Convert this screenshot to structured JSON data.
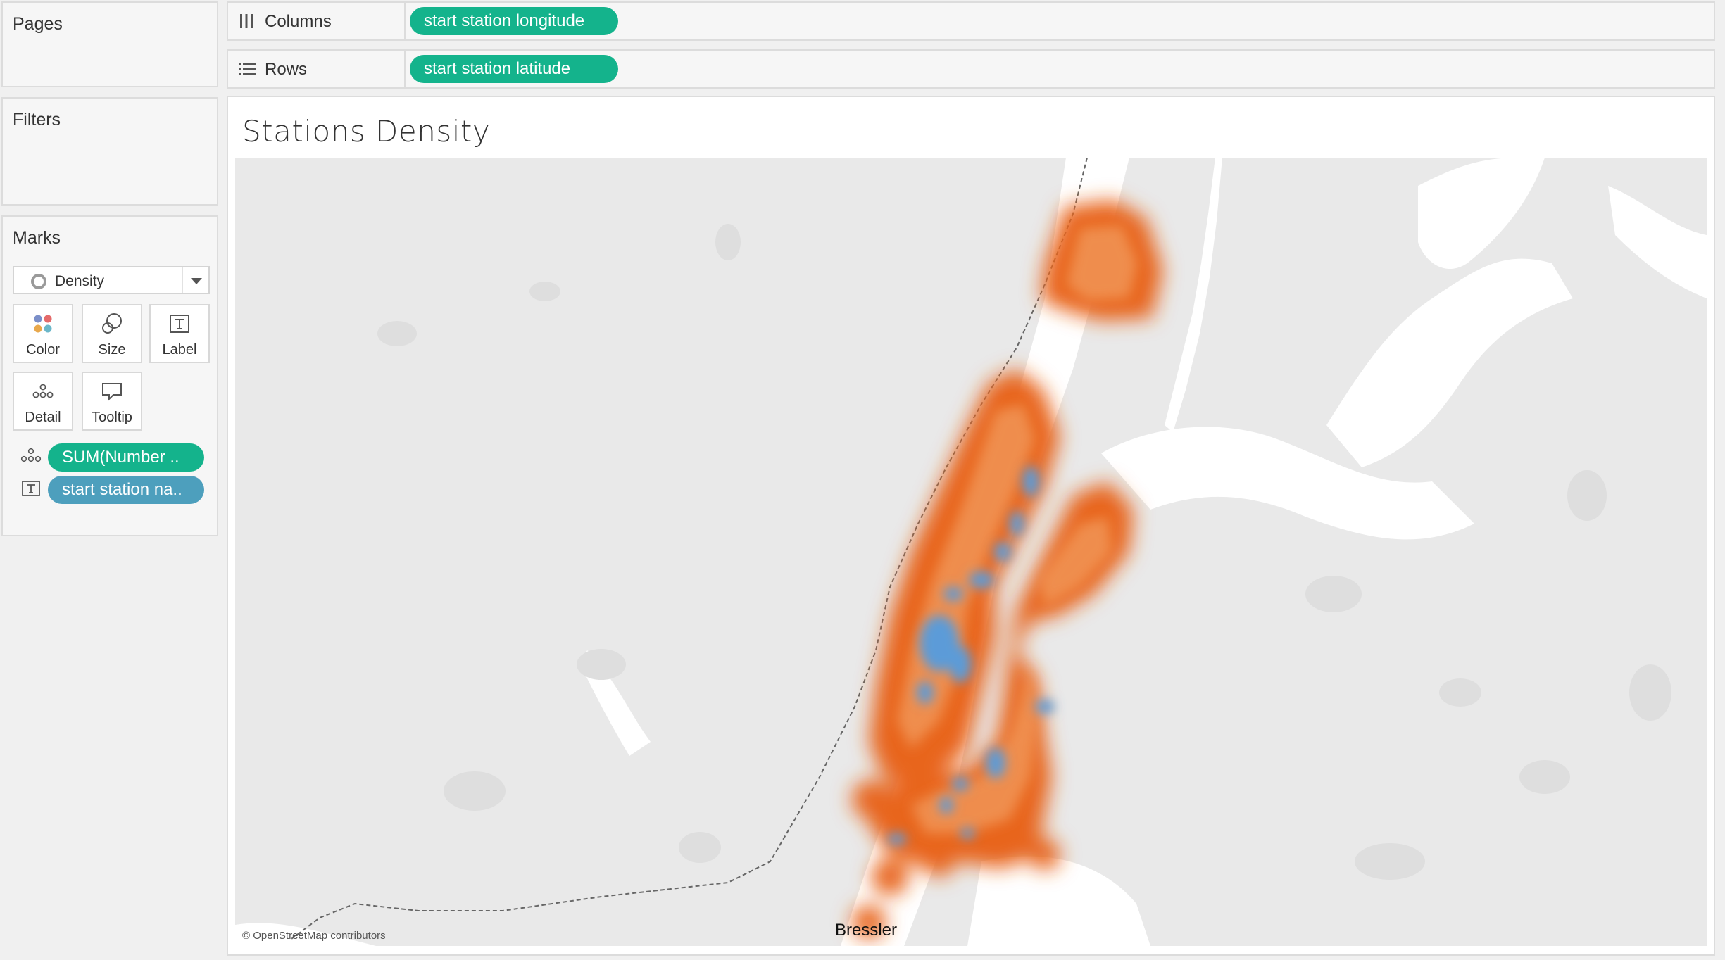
{
  "cards": {
    "pages": {
      "title": "Pages"
    },
    "filters": {
      "title": "Filters"
    },
    "marks": {
      "title": "Marks",
      "mark_type": "Density",
      "buttons": {
        "color": "Color",
        "size": "Size",
        "label": "Label",
        "detail": "Detail",
        "tooltip": "Tooltip"
      },
      "fields": [
        {
          "text": "SUM(Number ..",
          "type": "detail",
          "color": "#14b38c"
        },
        {
          "text": "start station na..",
          "type": "label",
          "color": "#4d9fbd"
        }
      ]
    }
  },
  "shelves": {
    "columns": {
      "label": "Columns",
      "pill": "start station longitude"
    },
    "rows": {
      "label": "Rows",
      "pill": "start station latitude"
    }
  },
  "viz": {
    "title": "Stations Density",
    "attribution": "© OpenStreetMap contributors",
    "map_label": "Bressler"
  },
  "colors": {
    "density_low": "#e8651c",
    "density_high": "#5b9bd8",
    "map_land": "#e9e9e9",
    "map_water": "#ffffff"
  }
}
